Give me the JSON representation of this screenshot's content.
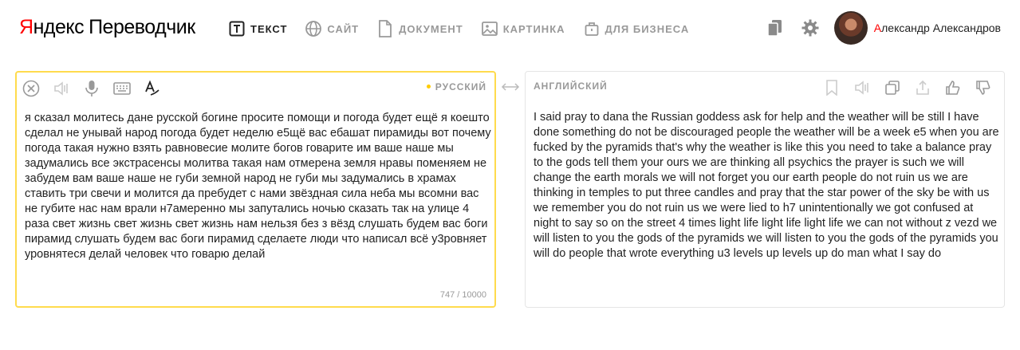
{
  "logo": {
    "y_letter": "Я",
    "rest": "ндекс",
    "product": "Переводчик"
  },
  "nav": [
    {
      "icon": "text-icon",
      "label": "ТЕКСТ",
      "active": true
    },
    {
      "icon": "globe-icon",
      "label": "САЙТ",
      "active": false
    },
    {
      "icon": "document-icon",
      "label": "ДОКУМЕНТ",
      "active": false
    },
    {
      "icon": "image-icon",
      "label": "КАРТИНКА",
      "active": false
    },
    {
      "icon": "briefcase-icon",
      "label": "ДЛЯ БИЗНЕСА",
      "active": false
    }
  ],
  "user": {
    "first_letter": "А",
    "name_rest": "лександр Александров"
  },
  "source": {
    "lang": "РУССКИЙ",
    "text": "я сказал молитесь дане русской богине просите помощи и погода будет ещё я коешто сделал не унывай народ погода будет неделю е5щё вас ебашат пирамиды вот почему погода такая нужно взять равновесие молите богов говарите им ваше наше мы задумались все экстрасенсы молитва такая нам отмерена земля нравы поменяем не забудем вам ваше наше не губи земной народ не губи мы задумались в храмах ставить три свечи и молится да пребудет с нами звёздная сила неба мы всомни вас не губите нас нам врали н7амеренно мы запутались ночью сказать так на улице 4 раза свет жизнь свет жизнь свет жизнь нам нельзя без з вёзд слушать будем вас боги пирамид слушать будем вас боги пирамид сделаете люди что написал всё у3ровняет уровнятеся делай человек что говарю делай",
    "counter": "747 / 10000"
  },
  "target": {
    "lang": "АНГЛИЙСКИЙ",
    "text": "I said pray to dana the Russian goddess ask for help and the weather will be still I have done something do not be discouraged people the weather will be a week e5 when you are fucked by the pyramids that's why the weather is like this you need to take a balance pray to the gods tell them your ours we are thinking all psychics the prayer is such we will change the earth morals we will not forget you our earth people do not ruin us we are thinking in temples to put three candles and pray that the star power of the sky be with us we remember you do not ruin us we were lied to h7 unintentionally we got confused at night to say so on the street 4 times light life light life light life we can not without z vezd we will listen to you the gods of the pyramids we will listen to you the gods of the pyramids you will do people that wrote everything u3 levels up levels up do man what I say do"
  },
  "colors": {
    "accent": "#ffdb4d",
    "brand_red": "#ff0000",
    "muted": "#999999"
  }
}
